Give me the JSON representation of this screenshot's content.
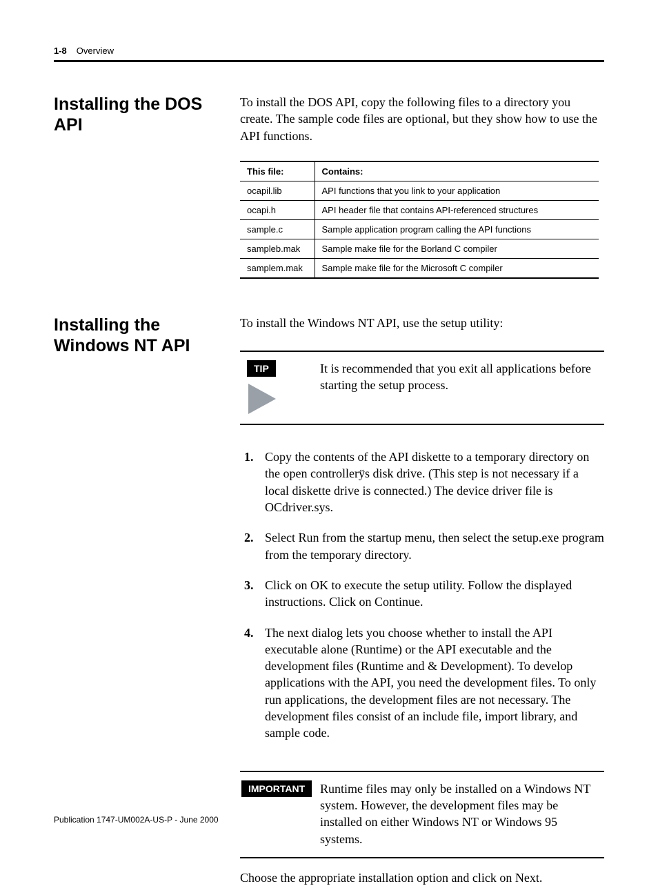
{
  "header": {
    "page_number": "1-8",
    "section": "Overview"
  },
  "sections": {
    "dos": {
      "heading": "Installing the DOS API",
      "intro": "To install the DOS API, copy the following files to a directory you create. The sample code files are optional, but they show how to use the API functions.",
      "table": {
        "headers": [
          "This file:",
          "Contains:"
        ],
        "rows": [
          [
            "ocapil.lib",
            "API functions that you link to your application"
          ],
          [
            "ocapi.h",
            "API header file that contains API-referenced structures"
          ],
          [
            "sample.c",
            "Sample application program calling the API functions"
          ],
          [
            "sampleb.mak",
            "Sample make file for the Borland C compiler"
          ],
          [
            "samplem.mak",
            "Sample make file for the Microsoft C compiler"
          ]
        ]
      }
    },
    "nt": {
      "heading": "Installing the Windows NT API",
      "intro": "To install the Windows NT API, use the setup utility:",
      "tip_label": "TIP",
      "tip_body": "It is recommended that you exit all applications before starting the setup process.",
      "steps": [
        "Copy the contents of the API diskette to a temporary directory on the open controllerÿs disk drive. (This step is not necessary if a local diskette drive is connected.) The device driver file is OCdriver.sys.",
        "Select Run from the startup menu, then select the setup.exe program from the temporary directory.",
        "Click on OK to execute the setup utility. Follow the displayed instructions. Click on Continue.",
        "The next dialog lets you choose whether to install the API executable alone (Runtime) or the API executable and the development files (Runtime and & Development). To develop applications with the API, you need the development files. To only run applications, the development files are not necessary. The development files consist of an include file, import library, and sample code."
      ],
      "important_label": "IMPORTANT",
      "important_body": "Runtime files may only be installed on a Windows NT system. However, the development files may be installed on either Windows NT or Windows 95 systems.",
      "after_important": "Choose the appropriate installation option and click on Next."
    }
  },
  "footer": {
    "pub": "Publication 1747-UM002A-US-P - June 2000"
  }
}
